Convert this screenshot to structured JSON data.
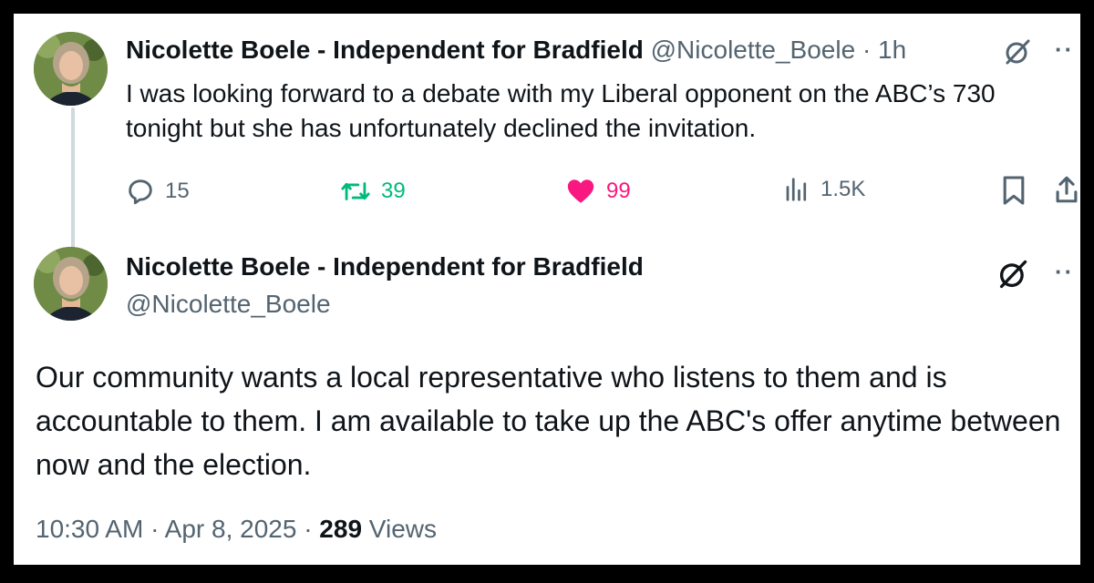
{
  "tweet1": {
    "display_name": "Nicolette Boele - Independent for Bradfield",
    "handle": "@Nicolette_Boele",
    "time": "· 1h",
    "text": "I was looking forward to a debate with my Liberal opponent on the ABC’s 730 tonight but she has unfortunately declined the invitation.",
    "replies": "15",
    "reposts": "39",
    "likes": "99",
    "views": "1.5K"
  },
  "tweet2": {
    "display_name": "Nicolette Boele - Independent for Bradfield",
    "handle": "@Nicolette_Boele",
    "text": "Our community wants a local representative who listens to them and is accountable to them. I am available to take up the ABC's offer anytime between now and the election.",
    "timestamp": "10:30 AM · Apr 8, 2025 ·",
    "view_count": "289",
    "views_label": "Views"
  },
  "colors": {
    "reply": "#536471",
    "repost": "#00ba7c",
    "like": "#f91880",
    "text": "#0f1419"
  },
  "icons": [
    "avatar",
    "grok-icon",
    "more-icon",
    "reply-icon",
    "repost-icon",
    "like-icon",
    "views-icon",
    "bookmark-icon",
    "share-icon"
  ]
}
